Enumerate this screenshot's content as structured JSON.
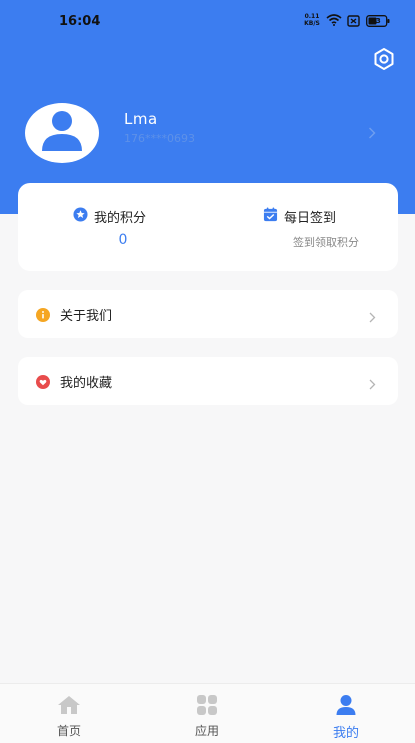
{
  "status_bar": {
    "time": "16:04",
    "net_speed_value": "0.11",
    "net_speed_unit": "KB/S",
    "battery": "43"
  },
  "header": {
    "background_color": "#3c7df0",
    "settings_icon": "hexagon-settings-icon"
  },
  "profile": {
    "username": "Lma",
    "phone": "176****0693",
    "avatar_icon": "user-avatar-icon"
  },
  "points_card": {
    "my_points": {
      "label": "我的积分",
      "value": "0",
      "icon": "star-badge-icon"
    },
    "daily_checkin": {
      "label": "每日签到",
      "sublabel": "签到领取积分",
      "icon": "calendar-check-icon"
    }
  },
  "menu": [
    {
      "label": "关于我们",
      "icon": "info-icon",
      "icon_color": "#f5a623"
    },
    {
      "label": "我的收藏",
      "icon": "heart-icon",
      "icon_color": "#e84c4c"
    }
  ],
  "tab_bar": {
    "accent_color": "#3c7df0",
    "tabs": [
      {
        "label": "首页",
        "icon": "home-icon",
        "active": false
      },
      {
        "label": "应用",
        "icon": "apps-grid-icon",
        "active": false
      },
      {
        "label": "我的",
        "icon": "profile-icon",
        "active": true
      }
    ]
  }
}
